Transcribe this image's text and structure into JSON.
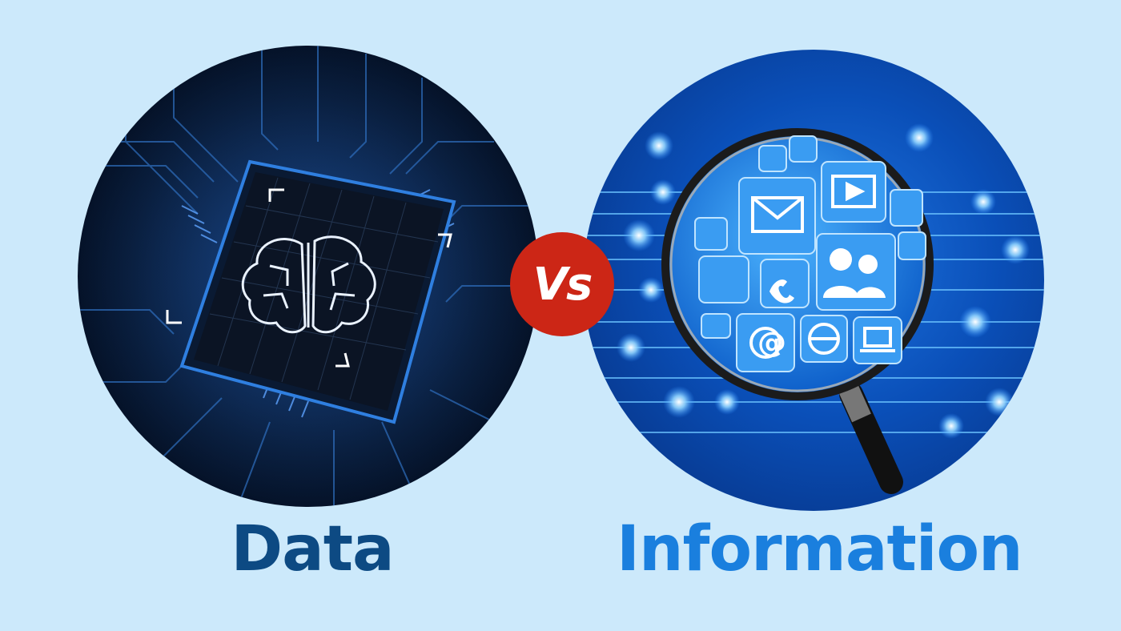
{
  "labels": {
    "left": "Data",
    "center": "Vs",
    "right": "Information"
  },
  "colors": {
    "background": "#cce9fb",
    "data_text": "#0d4a83",
    "information_text": "#1a7fde",
    "vs_badge": "#cc2616"
  },
  "icons": {
    "left_circle": "brain-chip-icon",
    "right_circle": "magnifying-glass-icon",
    "apps": [
      "home-icon",
      "link-icon",
      "gear-icon",
      "music-note-icon",
      "email-icon",
      "video-icon",
      "download-icon",
      "antenna-icon",
      "bird-icon",
      "users-icon",
      "paperclip-icon",
      "camcorder-icon",
      "phone-icon",
      "share-icon",
      "camera-icon",
      "at-sign-icon",
      "globe-icon",
      "laptop-icon",
      "monitor-icon"
    ]
  }
}
